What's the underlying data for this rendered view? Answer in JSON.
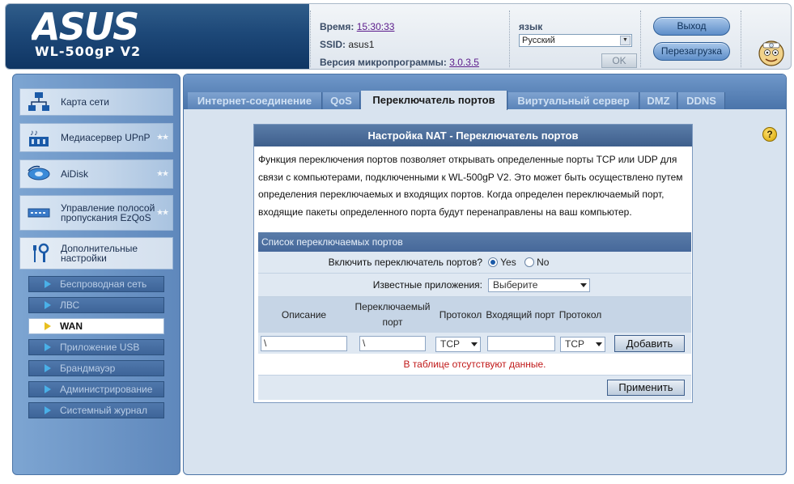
{
  "header": {
    "brand": "ASUS",
    "model": "WL-500gP V2",
    "time_label": "Время:",
    "time_value": "15:30:33",
    "ssid_label": "SSID:",
    "ssid_value": "asus1",
    "firmware_label": "Версия микропрограммы:",
    "firmware_value": "3.0.3.5",
    "language_label": "язык",
    "language_value": "Русский",
    "ok_label": "OK",
    "logout_label": "Выход",
    "reboot_label": "Перезагрузка"
  },
  "sidebar": {
    "main_items": [
      {
        "label": "Карта сети",
        "icon": "network-map-icon"
      },
      {
        "label": "Медиасервер UPnP",
        "icon": "media-server-icon"
      },
      {
        "label": "AiDisk",
        "icon": "aidisk-icon"
      },
      {
        "label": "Управление полосой пропускания EzQoS",
        "icon": "bandwidth-icon"
      },
      {
        "label": "Дополнительные настройки",
        "icon": "tools-icon"
      }
    ],
    "sub_items": [
      {
        "label": "Беспроводная сеть",
        "active": false
      },
      {
        "label": "ЛВС",
        "active": false
      },
      {
        "label": "WAN",
        "active": true
      },
      {
        "label": "Приложение USB",
        "active": false
      },
      {
        "label": "Брандмауэр",
        "active": false
      },
      {
        "label": "Администрирование",
        "active": false
      },
      {
        "label": "Системный журнал",
        "active": false
      }
    ]
  },
  "tabs": [
    {
      "label": "Интернет-соединение",
      "active": false
    },
    {
      "label": "QoS",
      "active": false
    },
    {
      "label": "Переключатель портов",
      "active": true
    },
    {
      "label": "Виртуальный сервер",
      "active": false
    },
    {
      "label": "DMZ",
      "active": false
    },
    {
      "label": "DDNS",
      "active": false
    }
  ],
  "panel": {
    "title": "Настройка NAT - Переключатель портов",
    "description": "Функция переключения портов позволяет открывать определенные порты TCP или UDP для связи с компьютерами, подключенными к WL-500gP V2. Это может быть осуществлено путем определения переключаемых и входящих портов. Когда определен переключаемый порт, входящие пакеты определенного порта будут перенаправлены на ваш компьютер.",
    "list_title": "Список переключаемых портов",
    "enable_label": "Включить переключатель портов?",
    "yes_label": "Yes",
    "no_label": "No",
    "enabled": true,
    "known_apps_label": "Известные приложения:",
    "known_apps_value": "Выберите",
    "columns": {
      "description": "Описание",
      "trigger_port": "Переключаемый порт",
      "protocol": "Протокол",
      "incoming_port": "Входящий порт",
      "protocol2": "Протокол"
    },
    "inputs": {
      "description_value": "\\",
      "trigger_port_value": "\\",
      "protocol_value": "TCP",
      "incoming_port_value": "",
      "protocol2_value": "TCP"
    },
    "add_label": "Добавить",
    "empty_message": "В таблице отсутствуют данные.",
    "apply_label": "Применить"
  },
  "colors": {
    "header_blue": "#1d4878",
    "sidebar_blue": "#5f88bc",
    "panel_title": "#3e5f8c",
    "error_red": "#c01818"
  }
}
